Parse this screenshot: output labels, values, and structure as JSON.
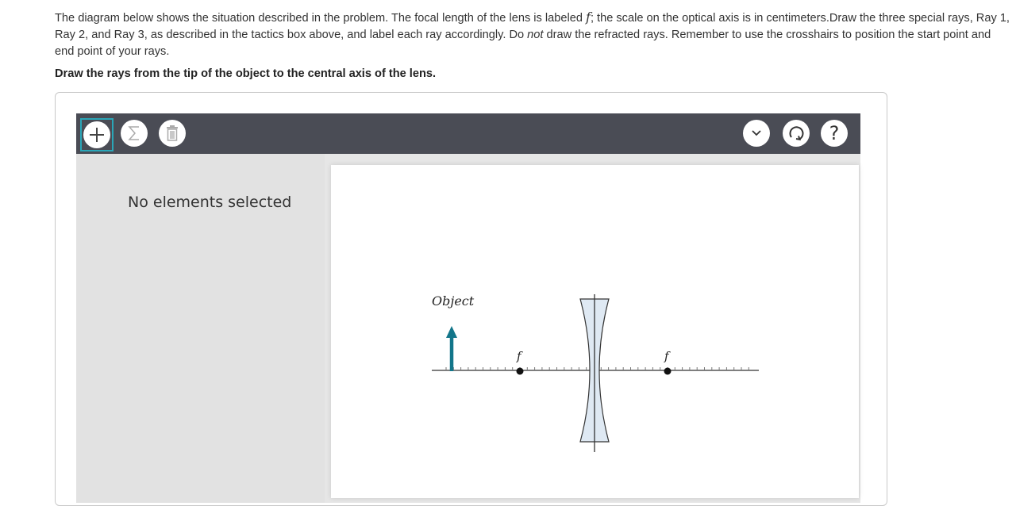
{
  "instructions": {
    "part1": "The diagram below shows the situation described in the problem. The focal length of the lens is labeled ",
    "focal_symbol": "f",
    "part2": "; the scale on the optical axis is in centimeters.Draw the three special rays, Ray 1, Ray 2, and Ray 3, as described in the tactics box above, and label each ray accordingly. Do ",
    "emphasis": "not",
    "part3": " draw the refracted rays. Remember to use the crosshairs to position the start point and end point of your rays."
  },
  "prompt": "Draw the rays from the tip of the object to the central axis of the lens.",
  "toolbar": {
    "left_icons": [
      "plus-icon",
      "sigma-icon",
      "trash-icon"
    ],
    "right_icons": [
      "chevron-down-icon",
      "reset-icon",
      "help-icon"
    ],
    "help_glyph": "?"
  },
  "side_panel": {
    "status": "No elements selected"
  },
  "diagram": {
    "object_label": "Object",
    "focal_label_left": "f",
    "focal_label_right": "f",
    "colors": {
      "object_arrow": "#13768a",
      "axis": "#333333",
      "lens_fill": "#dfe9f3",
      "lens_stroke": "#333333"
    }
  },
  "colors": {
    "toolbar_bg": "#4a4c55",
    "active_outline": "#2aa6b8",
    "side_panel_bg": "#e2e2e2"
  }
}
